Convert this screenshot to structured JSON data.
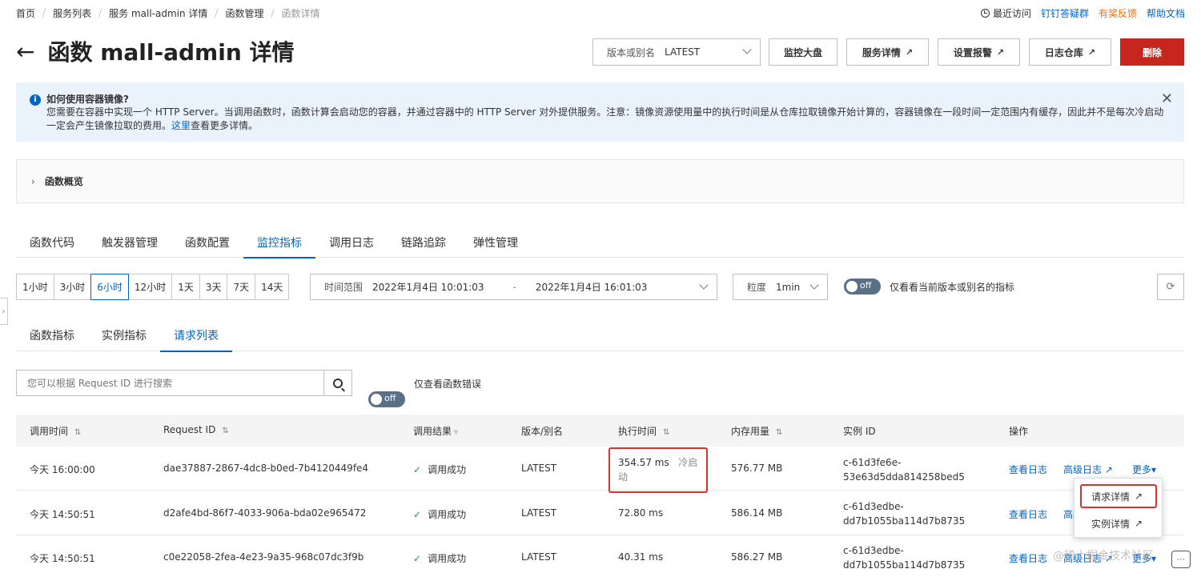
{
  "breadcrumb": [
    "首页",
    "服务列表",
    "服务 mall-admin 详情",
    "函数管理",
    "函数详情"
  ],
  "top_links": {
    "recent": "最近访问",
    "dingtalk": "钉钉答疑群",
    "feedback": "有奖反馈",
    "help": "帮助文档"
  },
  "page_title": "函数 mall-admin 详情",
  "version_select": {
    "label": "版本或别名",
    "value": "LATEST"
  },
  "header_buttons": {
    "monitor": "监控大盘",
    "service_detail": "服务详情",
    "alarm": "设置报警",
    "log_store": "日志仓库",
    "delete": "删除"
  },
  "notice": {
    "title": "如何使用容器镜像?",
    "body": "您需要在容器中实现一个 HTTP Server。当调用函数时，函数计算会启动您的容器，并通过容器中的 HTTP Server 对外提供服务。注意：镜像资源使用量中的执行时间是从仓库拉取镜像开始计算的，容器镜像在一段时间一定范围内有缓存，因此并不是每次冷启动一定会产生镜像拉取的费用。",
    "link": "这里",
    "tail": "查看更多详情。"
  },
  "overview_label": "函数概览",
  "main_tabs": [
    "函数代码",
    "触发器管理",
    "函数配置",
    "监控指标",
    "调用日志",
    "链路追踪",
    "弹性管理"
  ],
  "main_tab_active": "监控指标",
  "time_ranges": [
    "1小时",
    "3小时",
    "6小时",
    "12小时",
    "1天",
    "3天",
    "7天",
    "14天"
  ],
  "time_range_active": "6小时",
  "time_picker": {
    "label": "时间范围",
    "start": "2022年1月4日 10:01:03",
    "separator": "-",
    "end": "2022年1月4日 16:01:03"
  },
  "granularity": {
    "label": "粒度",
    "value": "1min"
  },
  "switch_version": {
    "state": "off",
    "label": "仅看看当前版本或别名的指标"
  },
  "sub_tabs": [
    "函数指标",
    "实例指标",
    "请求列表"
  ],
  "sub_tab_active": "请求列表",
  "search": {
    "placeholder": "您可以根据 Request ID 进行搜索"
  },
  "switch_error": {
    "state": "off",
    "label": "仅查看函数错误"
  },
  "table": {
    "headers": [
      "调用时间",
      "Request ID",
      "调用结果",
      "版本/别名",
      "执行时间",
      "内存用量",
      "实例 ID",
      "操作"
    ],
    "rows": [
      {
        "time": "今天 16:00:00",
        "request_id": "dae37887-2867-4dc8-b0ed-7b4120449fe4",
        "result": "调用成功",
        "version": "LATEST",
        "duration": "354.57 ms",
        "cold": "冷启动",
        "memory": "576.77 MB",
        "instance_a": "c-61d3fe6e-",
        "instance_b": "53e63d5dda814258bed5"
      },
      {
        "time": "今天 14:50:51",
        "request_id": "d2afe4bd-86f7-4033-906a-bda02e965472",
        "result": "调用成功",
        "version": "LATEST",
        "duration": "72.80 ms",
        "cold": "",
        "memory": "586.14 MB",
        "instance_a": "c-61d3edbe-",
        "instance_b": "dd7b1055ba114d7b8735"
      },
      {
        "time": "今天 14:50:51",
        "request_id": "c0e22058-2fea-4e23-9a35-968c07dc3f9b",
        "result": "调用成功",
        "version": "LATEST",
        "duration": "40.31 ms",
        "cold": "",
        "memory": "586.27 MB",
        "instance_a": "c-61d3edbe-",
        "instance_b": "dd7b1055ba114d7b8735"
      }
    ],
    "actions": {
      "view_log": "查看日志",
      "advanced_log": "高级日志",
      "more": "更多"
    }
  },
  "more_menu": [
    "请求详情",
    "实例详情"
  ],
  "watermark": "@稀土掘金技术社区",
  "colors": {
    "primary": "#0064c8",
    "danger": "#c7261f",
    "highlight": "#d9312c",
    "success": "#1e9d3f"
  }
}
